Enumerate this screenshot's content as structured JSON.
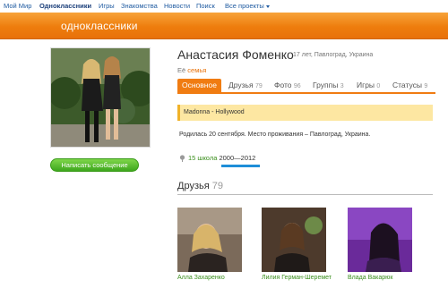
{
  "topnav": {
    "items": [
      "Мой Мир",
      "Одноклассники",
      "Игры",
      "Знакомства",
      "Новости",
      "Поиск",
      "Все проекты"
    ]
  },
  "header": {
    "brand": "одноклассники"
  },
  "profile": {
    "name": "Анастасия Фоменко",
    "meta": "17 лет, Павлоград, Украина",
    "family_prefix": "Её",
    "family_link": "семья",
    "message_button": "Написать сообщение",
    "status": "Madonna - Hollywood",
    "born": "Родилась 20 сентября. Место проживания – Павлоград, Украина."
  },
  "tabs": [
    {
      "label": "Основное",
      "count": ""
    },
    {
      "label": "Друзья",
      "count": "79"
    },
    {
      "label": "Фото",
      "count": "96"
    },
    {
      "label": "Группы",
      "count": "3"
    },
    {
      "label": "Игры",
      "count": "0"
    },
    {
      "label": "Статусы",
      "count": "9"
    }
  ],
  "school": {
    "name": "15 школа",
    "start": "2000",
    "dash": "—",
    "end": "2012"
  },
  "friends": {
    "title": "Друзья",
    "count": "79",
    "items": [
      {
        "name": "Алла Захаренко"
      },
      {
        "name": "Лилия Герман-Шеремет"
      },
      {
        "name": "Влада Вакарюк"
      }
    ]
  },
  "colors": {
    "brand_orange": "#ee7d0d",
    "link_green": "#3b8f1e",
    "link_blue": "#1e5aa0"
  }
}
